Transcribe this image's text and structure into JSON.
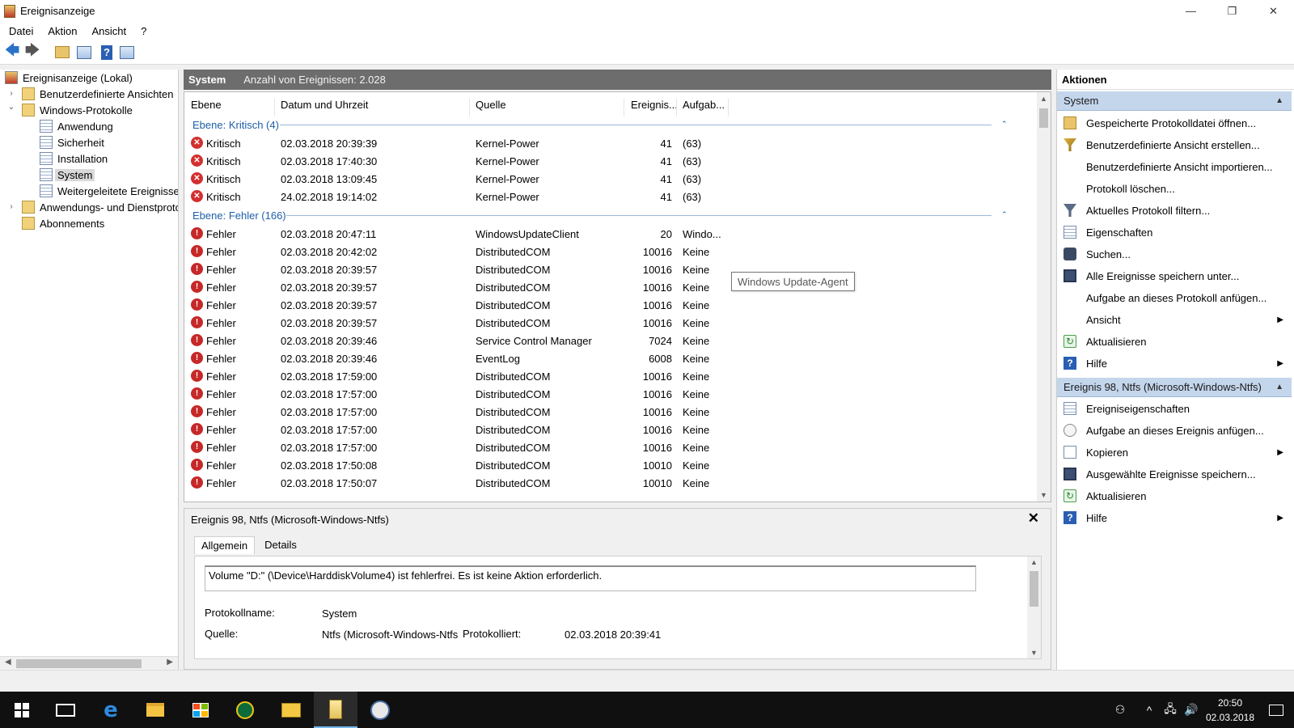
{
  "window": {
    "title": "Ereignisanzeige",
    "minimize_glyph": "—",
    "restore_glyph": "❐",
    "close_glyph": "✕"
  },
  "menu": [
    "Datei",
    "Aktion",
    "Ansicht",
    "?"
  ],
  "toolbar": {
    "icons": [
      "back-arrow-icon",
      "forward-arrow-icon",
      "open-folder-icon",
      "console-tree-icon",
      "help-icon",
      "action-pane-icon"
    ],
    "back_glyph": "🡄",
    "forward_glyph": "🡆",
    "help_glyph": "?"
  },
  "tree": {
    "root": "Ereignisanzeige (Lokal)",
    "custom_views": "Benutzerdefinierte Ansichten",
    "windows_logs": "Windows-Protokolle",
    "logs": [
      "Anwendung",
      "Sicherheit",
      "Installation",
      "System",
      "Weitergeleitete Ereignisse"
    ],
    "apps_services": "Anwendungs- und Dienstprotokolle",
    "subscriptions": "Abonnements",
    "selected": "System",
    "expander_collapsed": "›",
    "expander_expanded": "⌄"
  },
  "center": {
    "log_name": "System",
    "event_count": "Anzahl von Ereignissen: 2.028",
    "columns": [
      "Ebene",
      "Datum und Uhrzeit",
      "Quelle",
      "Ereignis...",
      "Aufgab..."
    ],
    "groups": [
      {
        "label": "Ebene: Kritisch (4)",
        "level": "crit",
        "rows": [
          {
            "level": "Kritisch",
            "date": "02.03.2018 20:39:39",
            "source": "Kernel-Power",
            "id": "41",
            "task": "(63)"
          },
          {
            "level": "Kritisch",
            "date": "02.03.2018 17:40:30",
            "source": "Kernel-Power",
            "id": "41",
            "task": "(63)"
          },
          {
            "level": "Kritisch",
            "date": "02.03.2018 13:09:45",
            "source": "Kernel-Power",
            "id": "41",
            "task": "(63)"
          },
          {
            "level": "Kritisch",
            "date": "24.02.2018 19:14:02",
            "source": "Kernel-Power",
            "id": "41",
            "task": "(63)"
          }
        ]
      },
      {
        "label": "Ebene: Fehler (166)",
        "level": "err",
        "rows": [
          {
            "level": "Fehler",
            "date": "02.03.2018 20:47:11",
            "source": "WindowsUpdateClient",
            "id": "20",
            "task": "Windo..."
          },
          {
            "level": "Fehler",
            "date": "02.03.2018 20:42:02",
            "source": "DistributedCOM",
            "id": "10016",
            "task": "Keine"
          },
          {
            "level": "Fehler",
            "date": "02.03.2018 20:39:57",
            "source": "DistributedCOM",
            "id": "10016",
            "task": "Keine"
          },
          {
            "level": "Fehler",
            "date": "02.03.2018 20:39:57",
            "source": "DistributedCOM",
            "id": "10016",
            "task": "Keine"
          },
          {
            "level": "Fehler",
            "date": "02.03.2018 20:39:57",
            "source": "DistributedCOM",
            "id": "10016",
            "task": "Keine"
          },
          {
            "level": "Fehler",
            "date": "02.03.2018 20:39:57",
            "source": "DistributedCOM",
            "id": "10016",
            "task": "Keine"
          },
          {
            "level": "Fehler",
            "date": "02.03.2018 20:39:46",
            "source": "Service Control Manager",
            "id": "7024",
            "task": "Keine"
          },
          {
            "level": "Fehler",
            "date": "02.03.2018 20:39:46",
            "source": "EventLog",
            "id": "6008",
            "task": "Keine"
          },
          {
            "level": "Fehler",
            "date": "02.03.2018 17:59:00",
            "source": "DistributedCOM",
            "id": "10016",
            "task": "Keine"
          },
          {
            "level": "Fehler",
            "date": "02.03.2018 17:57:00",
            "source": "DistributedCOM",
            "id": "10016",
            "task": "Keine"
          },
          {
            "level": "Fehler",
            "date": "02.03.2018 17:57:00",
            "source": "DistributedCOM",
            "id": "10016",
            "task": "Keine"
          },
          {
            "level": "Fehler",
            "date": "02.03.2018 17:57:00",
            "source": "DistributedCOM",
            "id": "10016",
            "task": "Keine"
          },
          {
            "level": "Fehler",
            "date": "02.03.2018 17:57:00",
            "source": "DistributedCOM",
            "id": "10016",
            "task": "Keine"
          },
          {
            "level": "Fehler",
            "date": "02.03.2018 17:50:08",
            "source": "DistributedCOM",
            "id": "10010",
            "task": "Keine"
          },
          {
            "level": "Fehler",
            "date": "02.03.2018 17:50:07",
            "source": "DistributedCOM",
            "id": "10010",
            "task": "Keine"
          }
        ]
      }
    ],
    "tooltip": "Windows Update-Agent",
    "crit_glyph": "✕",
    "err_glyph": "!",
    "group_toggle_glyph": "⌃"
  },
  "detail": {
    "title": "Ereignis 98, Ntfs (Microsoft-Windows-Ntfs)",
    "close_glyph": "✕",
    "tabs": [
      "Allgemein",
      "Details"
    ],
    "active_tab": "Allgemein",
    "message": "Volume \"D:\" (\\Device\\HarddiskVolume4) ist fehlerfrei. Es ist keine Aktion erforderlich.",
    "fields": {
      "log_name_label": "Protokollname:",
      "log_name_value": "System",
      "source_label": "Quelle:",
      "source_value": "Ntfs (Microsoft-Windows-Ntfs",
      "logged_label": "Protokolliert:",
      "logged_value": "02.03.2018 20:39:41"
    }
  },
  "actions": {
    "header": "Aktionen",
    "section1": "System",
    "section1_items": [
      {
        "label": "Gespeicherte Protokolldatei öffnen...",
        "icon": "open-folder-icon",
        "submenu": false
      },
      {
        "label": "Benutzerdefinierte Ansicht erstellen...",
        "icon": "filter-icon",
        "submenu": false
      },
      {
        "label": "Benutzerdefinierte Ansicht importieren...",
        "icon": "",
        "submenu": false
      },
      {
        "label": "Protokoll löschen...",
        "icon": "",
        "submenu": false
      },
      {
        "label": "Aktuelles Protokoll filtern...",
        "icon": "filter-icon",
        "submenu": false
      },
      {
        "label": "Eigenschaften",
        "icon": "properties-icon",
        "submenu": false
      },
      {
        "label": "Suchen...",
        "icon": "binoculars-icon",
        "submenu": false
      },
      {
        "label": "Alle Ereignisse speichern unter...",
        "icon": "save-icon",
        "submenu": false
      },
      {
        "label": "Aufgabe an dieses Protokoll anfügen...",
        "icon": "",
        "submenu": false
      },
      {
        "label": "Ansicht",
        "icon": "",
        "submenu": true
      },
      {
        "label": "Aktualisieren",
        "icon": "refresh-icon",
        "submenu": false
      },
      {
        "label": "Hilfe",
        "icon": "help-icon",
        "submenu": true
      }
    ],
    "section2": "Ereignis 98, Ntfs (Microsoft-Windows-Ntfs)",
    "section2_items": [
      {
        "label": "Ereigniseigenschaften",
        "icon": "properties-icon",
        "submenu": false
      },
      {
        "label": "Aufgabe an dieses Ereignis anfügen...",
        "icon": "task-icon",
        "submenu": false
      },
      {
        "label": "Kopieren",
        "icon": "copy-icon",
        "submenu": true
      },
      {
        "label": "Ausgewählte Ereignisse speichern...",
        "icon": "save-icon",
        "submenu": false
      },
      {
        "label": "Aktualisieren",
        "icon": "refresh-icon",
        "submenu": false
      },
      {
        "label": "Hilfe",
        "icon": "help-icon",
        "submenu": true
      }
    ],
    "collapse_glyph": "▲",
    "submenu_glyph": "▶",
    "refresh_glyph": "↻",
    "help_glyph": "?"
  },
  "taskbar": {
    "apps": [
      "start-icon",
      "task-view-icon",
      "edge-icon",
      "file-explorer-icon",
      "store-icon",
      "app-icon",
      "mail-icon",
      "event-viewer-icon",
      "app-icon"
    ],
    "active": "event-viewer-icon",
    "edge_glyph": "e",
    "time": "20:50",
    "date": "02.03.2018",
    "people_glyph": "⚇",
    "tray_up_glyph": "^",
    "network_glyph": "🖧",
    "volume_glyph": "🔊"
  },
  "colors": {
    "accent": "#1d5fa8",
    "header_gray": "#6d6d6d",
    "action_section": "#c4d6ec",
    "critical": "#d32f2f",
    "error": "#c62828",
    "taskbar": "#101010"
  }
}
